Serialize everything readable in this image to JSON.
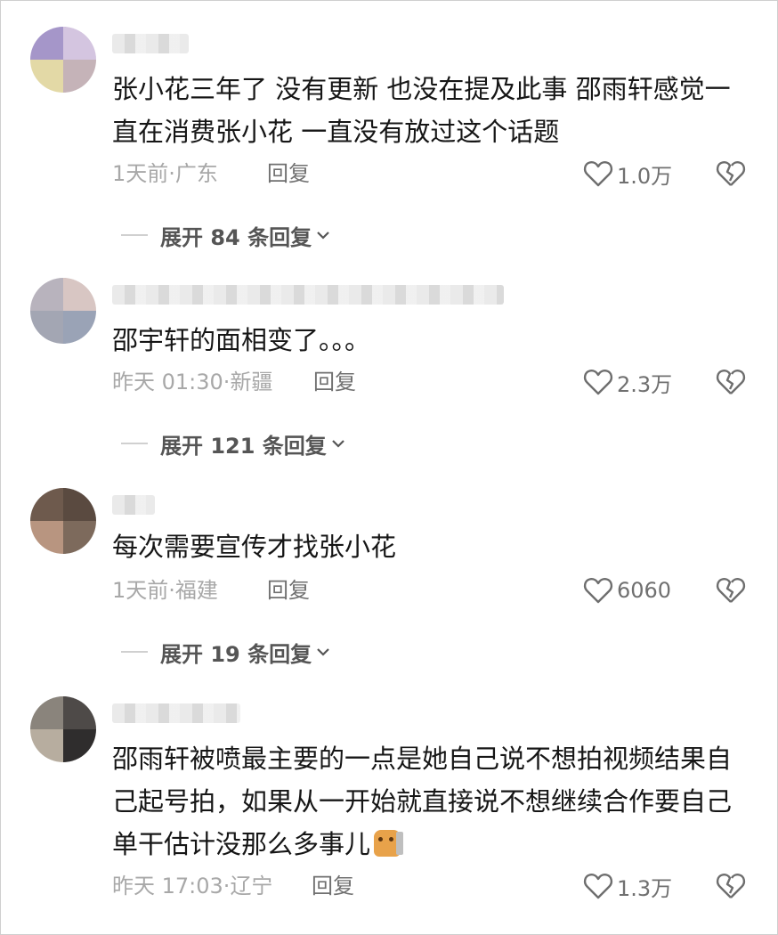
{
  "comments": [
    {
      "text": "张小花三年了 没有更新 也没在提及此事 邵雨轩感觉一直在消费张小花 一直没有放过这个话题",
      "time": "1天前",
      "location": "广东",
      "reply_label": "回复",
      "likes": "1.0万",
      "expand_label": "展开 84 条回复"
    },
    {
      "text": "邵宇轩的面相变了。。。",
      "time": "昨天 01:30",
      "location": "新疆",
      "reply_label": "回复",
      "likes": "2.3万",
      "expand_label": "展开 121 条回复"
    },
    {
      "text": "每次需要宣传才找张小花",
      "time": "1天前",
      "location": "福建",
      "reply_label": "回复",
      "likes": "6060",
      "expand_label": "展开 19 条回复"
    },
    {
      "text": "邵雨轩被喷最主要的一点是她自己说不想拍视频结果自己起号拍，如果从一开始就直接说不想继续合作要自己单干估计没那么多事儿",
      "time": "昨天 17:03",
      "location": "辽宁",
      "reply_label": "回复",
      "likes": "1.3万"
    }
  ],
  "icons": {
    "like": "heart-outline-icon",
    "dislike": "broken-heart-icon",
    "expand": "chevron-down-icon",
    "emoji": "cat-peeking-emoji"
  },
  "colors": {
    "text": "#161616",
    "meta": "#a8a8a8",
    "action": "#707070"
  }
}
